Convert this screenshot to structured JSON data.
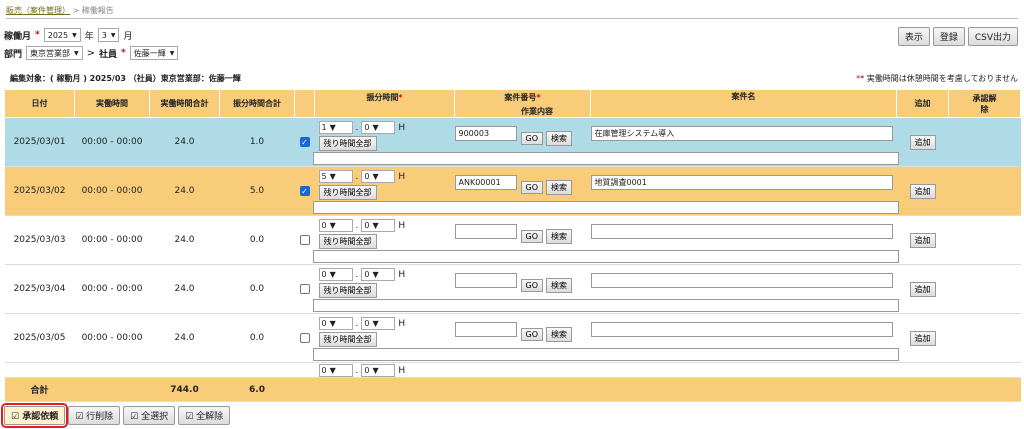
{
  "breadcrumb": {
    "parent": "販売（案件管理）",
    "sep": ">",
    "current": "稼働報告"
  },
  "filters": {
    "month_label": "稼働月",
    "year": "2025",
    "year_unit": "年",
    "month": "3",
    "month_unit": "月",
    "dept_label": "部門",
    "dept": "東京営業部",
    "arrow": ">",
    "staff_label": "社員",
    "staff": "佐藤一輝"
  },
  "actions": {
    "show": "表示",
    "register": "登録",
    "csv": "CSV出力"
  },
  "edit_target": "編集対象：( 稼動月 ) 2025/03 （社員）東京営業部：佐藤一輝",
  "note": "* 実働時間は休憩時間を考慮しておりません",
  "headers": {
    "date": "日付",
    "work": "実働時間",
    "total": "実働時間合計",
    "alloc": "振分時間合計",
    "alloc_time": "振分時間",
    "project_no": "案件番号",
    "project_name": "案件名",
    "work_content": "作業内容",
    "add": "追加",
    "approve": "承認解除"
  },
  "labels": {
    "remain": "残り時間全部",
    "go": "GO",
    "search": "検索",
    "add": "追加",
    "hour_unit": "H",
    "dot": "."
  },
  "rows": [
    {
      "date": "2025/03/01",
      "work": "00:00 - 00:00",
      "total": "24.0",
      "alloc": "1.0",
      "h": "1",
      "m": "0",
      "no": "900003",
      "name": "在庫管理システム導入",
      "checked": true
    },
    {
      "date": "2025/03/02",
      "work": "00:00 - 00:00",
      "total": "24.0",
      "alloc": "5.0",
      "h": "5",
      "m": "0",
      "no": "ANK00001",
      "name": "地質調査0001",
      "checked": true
    },
    {
      "date": "2025/03/03",
      "work": "00:00 - 00:00",
      "total": "24.0",
      "alloc": "0.0",
      "h": "0",
      "m": "0",
      "no": "",
      "name": "",
      "checked": false
    },
    {
      "date": "2025/03/04",
      "work": "00:00 - 00:00",
      "total": "24.0",
      "alloc": "0.0",
      "h": "0",
      "m": "0",
      "no": "",
      "name": "",
      "checked": false
    },
    {
      "date": "2025/03/05",
      "work": "00:00 - 00:00",
      "total": "24.0",
      "alloc": "0.0",
      "h": "0",
      "m": "0",
      "no": "",
      "name": "",
      "checked": false
    }
  ],
  "partial_row": {
    "h": "0",
    "m": "0"
  },
  "totals": {
    "label": "合計",
    "total": "744.0",
    "alloc": "6.0"
  },
  "bottom_buttons": {
    "approve": "承認依頼",
    "delete": "行削除",
    "select_all": "全選択",
    "deselect_all": "全解除"
  }
}
